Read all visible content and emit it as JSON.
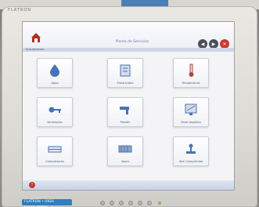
{
  "monitor": {
    "brand": "FLATRON",
    "model_badge": "FLATRON • HIGH RESOLUTION"
  },
  "header": {
    "title": "Planta de Servicios"
  },
  "subbar": {
    "label": "Sub-servicios"
  },
  "tiles": [
    {
      "label": "Agua",
      "icon": "water-drop-icon"
    },
    {
      "label": "Electricidad",
      "icon": "panel-icon"
    },
    {
      "label": "Temperatura",
      "icon": "thermometer-icon"
    },
    {
      "label": "Ventilación",
      "icon": "key-icon"
    },
    {
      "label": "Presión",
      "icon": "faucet-icon"
    },
    {
      "label": "Nivel depósito",
      "icon": "monitor-icon"
    },
    {
      "label": "Compresores",
      "icon": "rack-icon"
    },
    {
      "label": "Vapor",
      "icon": "boiler-icon"
    },
    {
      "label": "Aire Comprimido",
      "icon": "valve-icon"
    }
  ],
  "colors": {
    "accent": "#4d7fb7",
    "alert": "#c63a2e",
    "badge": "#2e7ec2"
  }
}
